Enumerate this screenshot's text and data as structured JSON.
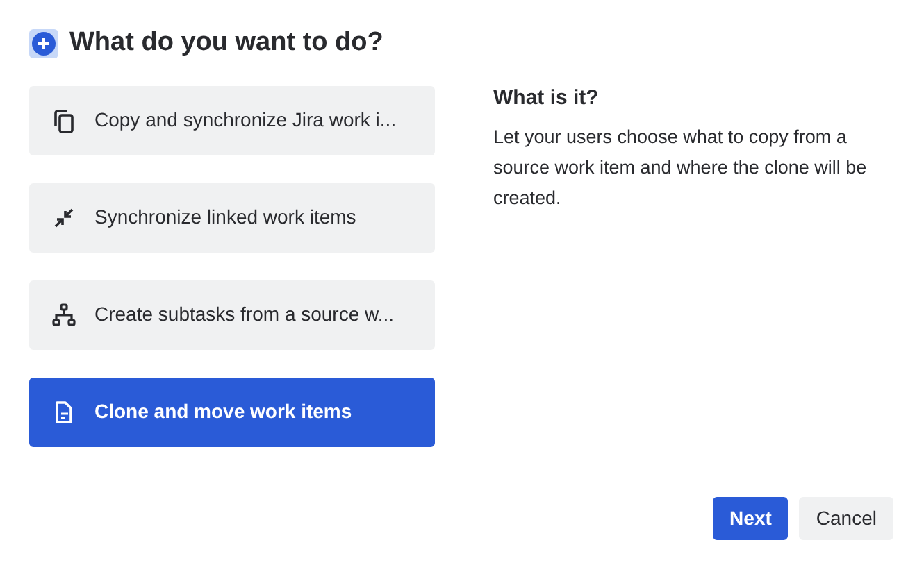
{
  "heading": "What do you want to do?",
  "options": [
    {
      "kind": "copy",
      "label": "Copy and synchronize Jira work i...",
      "selected": false
    },
    {
      "kind": "sync",
      "label": "Synchronize linked work items",
      "selected": false
    },
    {
      "kind": "tree",
      "label": "Create subtasks from a source w...",
      "selected": false
    },
    {
      "kind": "document",
      "label": "Clone and move work items",
      "selected": true
    }
  ],
  "info": {
    "title": "What is it?",
    "text": "Let your users choose what to copy from a source work item and where the clone will be created."
  },
  "buttons": [
    {
      "kind": "primary",
      "label": "Next"
    },
    {
      "kind": "secondary",
      "label": "Cancel"
    }
  ]
}
